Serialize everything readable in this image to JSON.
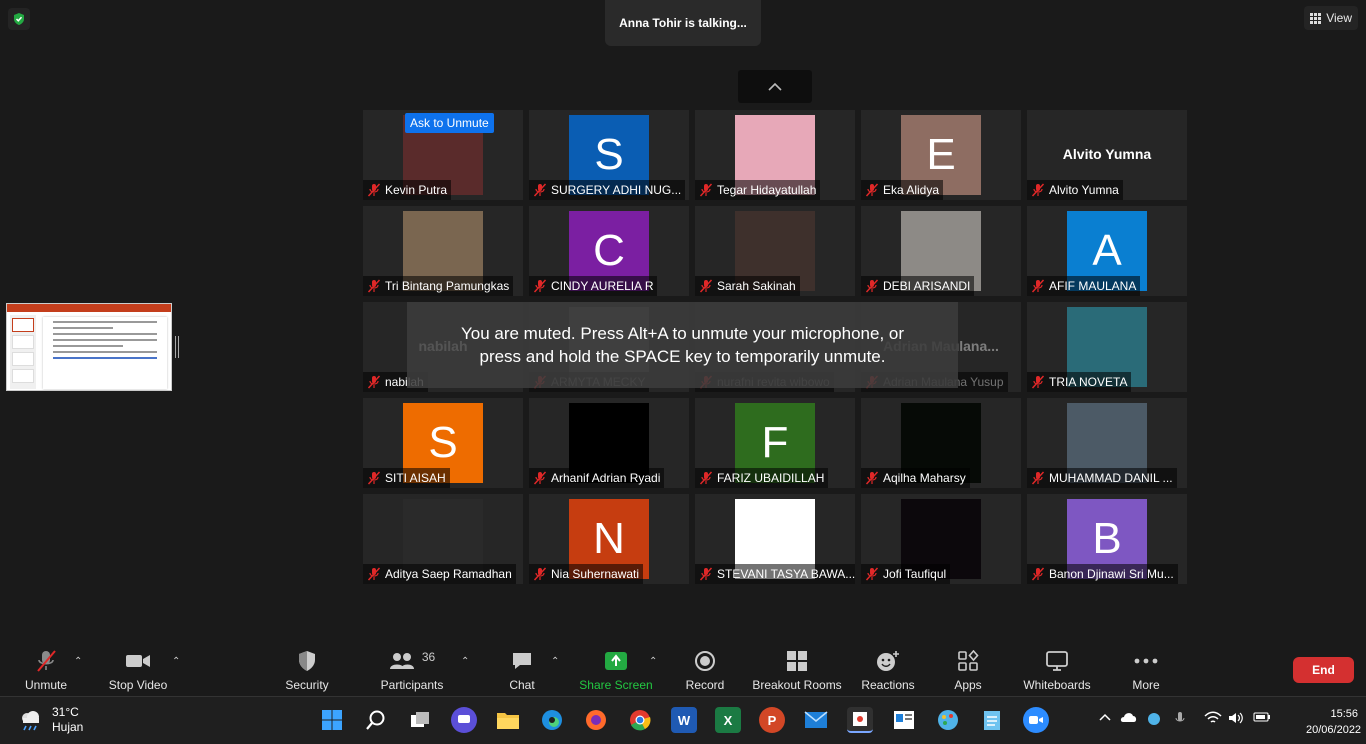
{
  "header": {
    "speaker_banner": "Anna Tohir is talking...",
    "view_label": "View"
  },
  "muted_toast": {
    "line1": "You are muted. Press Alt+A to unmute your microphone, or",
    "line2": "press and hold the SPACE key to temporarily unmute."
  },
  "ask_to_unmute": "Ask to Unmute",
  "participants": [
    {
      "name": "Kevin Putra",
      "avatar_type": "photo",
      "color": "#5a2b2b"
    },
    {
      "name": "SURGERY ADHI NUG...",
      "avatar_type": "letter",
      "letter": "S",
      "color": "#0a5db3"
    },
    {
      "name": "Tegar Hidayatullah",
      "avatar_type": "photo",
      "color": "#e7a8b8"
    },
    {
      "name": "Eka Alidya",
      "avatar_type": "letter",
      "letter": "E",
      "color": "#8e6d62"
    },
    {
      "name": "Alvito Yumna",
      "avatar_type": "text",
      "display_text": "Alvito Yumna"
    },
    {
      "name": "Tri Bintang Pamungkas",
      "avatar_type": "photo",
      "color": "#7a6650"
    },
    {
      "name": "CINDY AURELIA R",
      "avatar_type": "letter",
      "letter": "C",
      "color": "#7b1fa2"
    },
    {
      "name": "Sarah Sakinah",
      "avatar_type": "photo",
      "color": "#3e302c"
    },
    {
      "name": "DEBI ARISANDI",
      "avatar_type": "photo",
      "color": "#8d8a86"
    },
    {
      "name": "AFIF MAULANA",
      "avatar_type": "letter",
      "letter": "A",
      "color": "#0a7fd1"
    },
    {
      "name": "nabilah",
      "avatar_type": "text",
      "display_text": "nabilah"
    },
    {
      "name": "ARMYTA MECKY",
      "avatar_type": "photo",
      "color": "#555555"
    },
    {
      "name": "nurafni revita wibowo",
      "avatar_type": "none"
    },
    {
      "name": "Adrian Maulana Yusup",
      "avatar_type": "text",
      "display_text": "Adrian Maulana..."
    },
    {
      "name": "TRIA NOVETA",
      "avatar_type": "photo",
      "color": "#2a6b78"
    },
    {
      "name": "SITI AISAH",
      "avatar_type": "letter",
      "letter": "S",
      "color": "#ee6c00"
    },
    {
      "name": "Arhanif Adrian Ryadi",
      "avatar_type": "photo",
      "color": "#000000"
    },
    {
      "name": "FARIZ UBAIDILLAH",
      "avatar_type": "letter",
      "letter": "F",
      "color": "#2e6c1e"
    },
    {
      "name": "Aqilha Maharsy",
      "avatar_type": "photo",
      "color": "#060a06"
    },
    {
      "name": "MUHAMMAD DANIL ...",
      "avatar_type": "photo",
      "color": "#4c5a66"
    },
    {
      "name": "Aditya Saep Ramadhan",
      "avatar_type": "photo",
      "color": "#2a2a2a"
    },
    {
      "name": "Nia Suhernawati",
      "avatar_type": "letter",
      "letter": "N",
      "color": "#c63d10"
    },
    {
      "name": "STEVANI TASYA BAWA...",
      "avatar_type": "photo",
      "color": "#ffffff"
    },
    {
      "name": "Jofi Taufiqul",
      "avatar_type": "photo",
      "color": "#0c080c"
    },
    {
      "name": "Banon Djinawi Sri Mu...",
      "avatar_type": "letter",
      "letter": "B",
      "color": "#7e57c2"
    }
  ],
  "toolbar": {
    "unmute": "Unmute",
    "stop_video": "Stop Video",
    "security": "Security",
    "participants": "Participants",
    "participants_count": "36",
    "chat": "Chat",
    "share_screen": "Share Screen",
    "record": "Record",
    "breakout_rooms": "Breakout Rooms",
    "reactions": "Reactions",
    "apps": "Apps",
    "whiteboards": "Whiteboards",
    "more": "More",
    "end": "End"
  },
  "taskbar": {
    "temperature": "31°C",
    "weather": "Hujan",
    "time": "15:56",
    "date": "20/06/2022"
  },
  "colors": {
    "accent_blue": "#0e72ed",
    "share_green": "#23a942",
    "end_red": "#d43030"
  }
}
